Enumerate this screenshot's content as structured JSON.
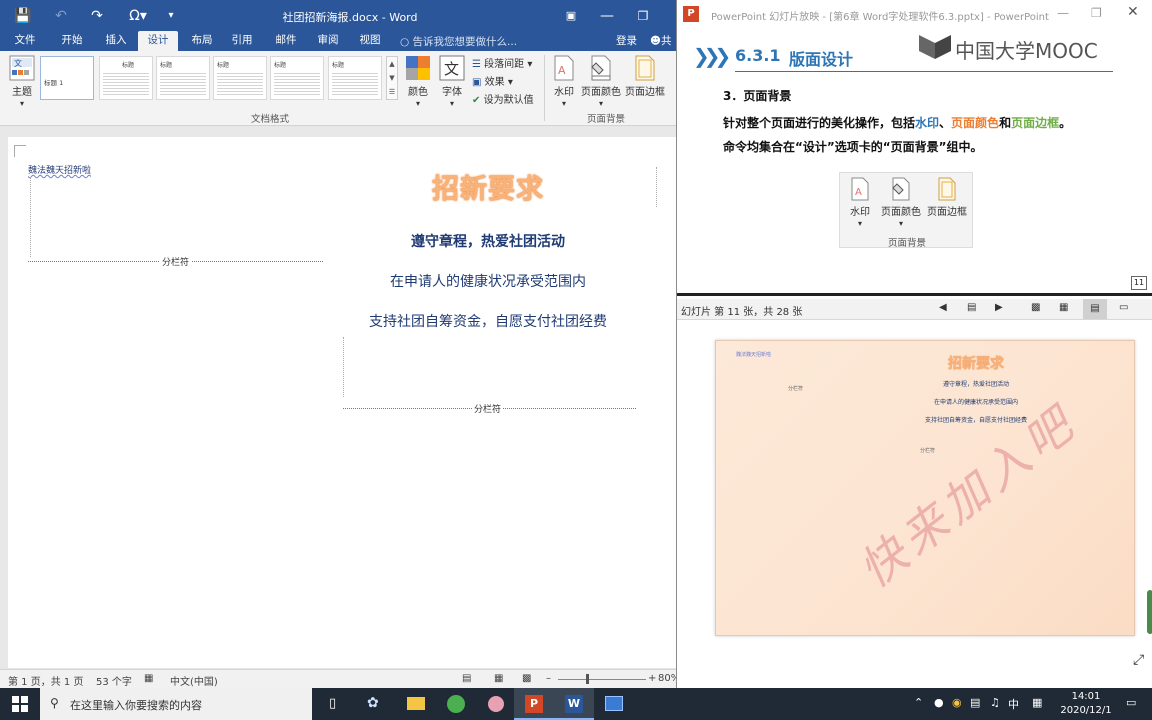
{
  "word": {
    "title_doc": "社团招新海报.docx - Word",
    "tabs": [
      "文件",
      "开始",
      "插入",
      "设计",
      "布局",
      "引用",
      "邮件",
      "审阅",
      "视图"
    ],
    "active_tab": "设计",
    "tell_me": "告诉我您想要做什么...",
    "sign_in": "登录",
    "share": "共",
    "ribbon": {
      "theme_label": "主题",
      "style_thumbs": [
        "标题",
        "标题",
        "标题",
        "标题",
        "标题",
        "标题"
      ],
      "style_thumb_first": "标题 1",
      "colors_label": "颜色",
      "fonts_label": "字体",
      "paragraph_spacing": "段落间距",
      "effects": "效果",
      "set_default": "设为默认值",
      "doc_format_group": "文档格式",
      "watermark": "水印",
      "page_color": "页面颜色",
      "page_borders": "页面边框",
      "page_background_group": "页面背景"
    },
    "doc": {
      "left_text": "魏法魏天招新啦",
      "section_break_1": "分栏符",
      "heading": "招新要求",
      "line1": "遵守章程，热爱社团活动",
      "line2": "在申请人的健康状况承受范围内",
      "line3": "支持社团自筹资金，自愿支付社团经费",
      "section_break_2": "分栏符"
    },
    "status": {
      "page": "第 1 页，共 1 页",
      "words": "53 个字",
      "language": "中文(中国)",
      "zoom": "80%"
    }
  },
  "ppt": {
    "title": "PowerPoint 幻灯片放映 - [第6章 Word字处理软件6.3.pptx] - PowerPoint",
    "slide": {
      "section_num": "6.3.1",
      "section_title": "版面设计",
      "mooc_logo": "中国大学MOOC",
      "heading": "3．页面背景",
      "desc_prefix": "针对整个页面进行的美化操作，包括",
      "kw_watermark": "水印",
      "sep1": "、",
      "kw_page_color": "页面颜色",
      "and": "和",
      "kw_page_border": "页面边框",
      "period": "。",
      "desc_line2": "命令均集合在“设计”选项卡的“页面背景”组中。",
      "btn_watermark": "水印",
      "btn_page_color": "页面颜色",
      "btn_page_border": "页面边框",
      "group_label": "页面背景",
      "page_num": "11"
    },
    "status": "幻灯片 第 11 张，共 28 张",
    "preview": {
      "left_text": "魏法魏天招新啦",
      "heading": "招新要求",
      "line1": "遵守章程，热爱社团活动",
      "line2": "在申请人的健康状况承受范围内",
      "line3": "支持社团自筹资金，自愿支付社团经费",
      "break1": "分栏符",
      "break2": "分栏符",
      "watermark": "快来加入吧"
    }
  },
  "taskbar": {
    "search_placeholder": "在这里输入你要搜索的内容",
    "ime": "中",
    "time": "14:01",
    "date": "2020/12/1"
  },
  "colors": {
    "word_blue": "#2b579a",
    "heading_orange": "#f08a3c",
    "doc_text_blue": "#1f3b73",
    "kw_blue": "#2e75b6",
    "kw_orange": "#ed7d31",
    "kw_green": "#70ad47",
    "watermark_red": "#e8a0a0"
  }
}
